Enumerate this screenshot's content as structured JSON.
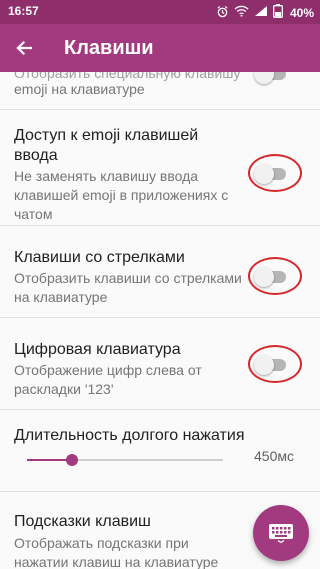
{
  "status_bar": {
    "time": "16:57",
    "battery": "40%",
    "icons": [
      "alarm-icon",
      "wifi-icon",
      "signal-icon",
      "battery-icon"
    ]
  },
  "app_bar": {
    "title": "Клавиши",
    "back_icon": "arrow-back-icon"
  },
  "settings": {
    "emoji_key": {
      "title": "Отобразить специальную клавишу",
      "desc": "emoji на клавиатуре"
    },
    "emoji_access": {
      "title": "Доступ к emoji клавишей ввода",
      "desc": "Не заменять клавишу ввода клавишей emoji в приложениях с чатом",
      "enabled": false
    },
    "arrow_keys": {
      "title": "Клавиши со стрелками",
      "desc": "Отобразить клавиши со стрелками на клавиатуре",
      "enabled": false
    },
    "numpad": {
      "title": "Цифровая клавиатура",
      "desc": "Отображение цифр слева от раскладки '123'",
      "enabled": false
    },
    "long_press": {
      "title": "Длительность долгого нажатия",
      "value_label": "450мс",
      "fraction": 0.23
    },
    "key_hints": {
      "title": "Подсказки клавиш",
      "desc": "Отображать подсказки при нажатии клавиш на клавиатуре"
    }
  },
  "fab": {
    "icon": "keyboard-icon"
  },
  "colors": {
    "status_bar": "#8e2f6c",
    "accent": "#a13a7f",
    "annotation_ring": "#d7262a"
  }
}
